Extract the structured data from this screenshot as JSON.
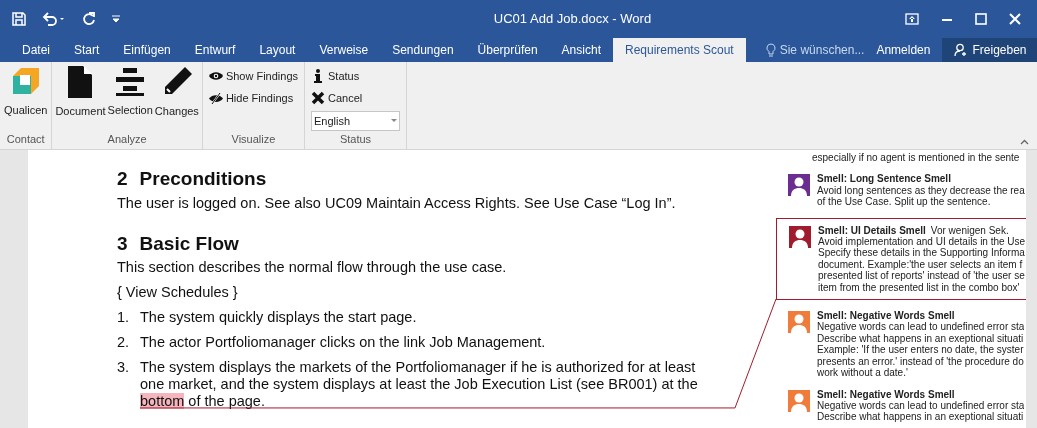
{
  "window": {
    "title": "UC01 Add Job.docx - Word"
  },
  "tabs": [
    {
      "label": "Datei",
      "selected": false
    },
    {
      "label": "Start",
      "selected": false
    },
    {
      "label": "Einfügen",
      "selected": false
    },
    {
      "label": "Entwurf",
      "selected": false
    },
    {
      "label": "Layout",
      "selected": false
    },
    {
      "label": "Verweise",
      "selected": false
    },
    {
      "label": "Sendungen",
      "selected": false
    },
    {
      "label": "Überprüfen",
      "selected": false
    },
    {
      "label": "Ansicht",
      "selected": false
    },
    {
      "label": "Requirements Scout",
      "selected": true
    }
  ],
  "tell_me": {
    "placeholder": "Sie wünschen..."
  },
  "account": {
    "sign_in": "Anmelden",
    "share": "Freigeben"
  },
  "ribbon": {
    "groups": [
      {
        "label": "Contact",
        "buttons": [
          {
            "kind": "logo",
            "label": "Qualicen"
          }
        ]
      },
      {
        "label": "Analyze",
        "buttons": [
          {
            "kind": "document",
            "label": "Document"
          },
          {
            "kind": "selection",
            "label": "Selection"
          },
          {
            "kind": "pencil",
            "label": "Changes"
          }
        ]
      },
      {
        "label": "Visualize",
        "small": [
          {
            "kind": "eye",
            "label": "Show Findings"
          },
          {
            "kind": "eye-off",
            "label": "Hide Findings"
          }
        ]
      },
      {
        "label": "Status",
        "small": [
          {
            "kind": "info",
            "label": "Status"
          },
          {
            "kind": "cross",
            "label": "Cancel"
          }
        ],
        "dropdown": {
          "value": "English"
        }
      }
    ]
  },
  "document": {
    "blocks": [
      {
        "kind": "heading",
        "number": "2",
        "text": "Preconditions"
      },
      {
        "kind": "para",
        "segments": [
          {
            "text": "The user is logged on. See also UC09 Maintain Access Rights. See Use Case “Log In”."
          }
        ]
      },
      {
        "kind": "heading",
        "number": "3",
        "text": "Basic Flow"
      },
      {
        "kind": "para",
        "segments": [
          {
            "text": "This section describes the normal flow through the use case."
          }
        ]
      },
      {
        "kind": "para",
        "segments": [
          {
            "text": "{ View Schedules }"
          }
        ]
      },
      {
        "kind": "item",
        "number": "1.",
        "segments": [
          {
            "text": "The system quickly displays the start page."
          }
        ]
      },
      {
        "kind": "item",
        "number": "2.",
        "segments": [
          {
            "text": "The actor Portfoliomanager clicks on the link Job Management."
          }
        ]
      },
      {
        "kind": "item",
        "number": "3.",
        "segments": [
          {
            "text": "The system displays the markets of the Portfoliomanager if he is authorized for at least one market, and the system displays at least the Job Execution List (see BR001) at the "
          },
          {
            "text": "bottom",
            "highlighted": true
          },
          {
            "text": " of the page."
          }
        ]
      }
    ]
  },
  "comments": [
    {
      "lines": [
        "especially if no agent is mentioned in the sente"
      ],
      "selected": false
    },
    {
      "title": "Smell: Long Sentence Smell",
      "color": "#6b2d8f",
      "selected": false,
      "lines": [
        "Avoid long sentences as they decrease the rea",
        "of the Use Case. Split up the sentence."
      ]
    },
    {
      "title": "Smell: UI Details Smell",
      "time": "Vor wenigen Sek.",
      "color": "#a01c2c",
      "selected": true,
      "lines": [
        "Avoid implementation and UI details in the Use",
        "Specify these details in the Supporting Informa",
        "document. Example:'the user selects an item f",
        "presented list of reports' instead of 'the user se",
        "item from the presented list in the combo box'"
      ]
    },
    {
      "title": "Smell: Negative Words Smell",
      "color": "#f07c3c",
      "selected": false,
      "lines": [
        "Negative words can lead to undefined error sta",
        "Describe what happens in an exeptional situati",
        "Example: 'If the user enters no date, the syster",
        "presents an error.' instead of 'the procedure do",
        "work without a date.'"
      ]
    },
    {
      "title": "Smell: Negative Words Smell",
      "color": "#f07c3c",
      "selected": false,
      "lines": [
        "Negative words can lead to undefined error sta",
        "Describe what happens in an exeptional situati"
      ]
    }
  ]
}
